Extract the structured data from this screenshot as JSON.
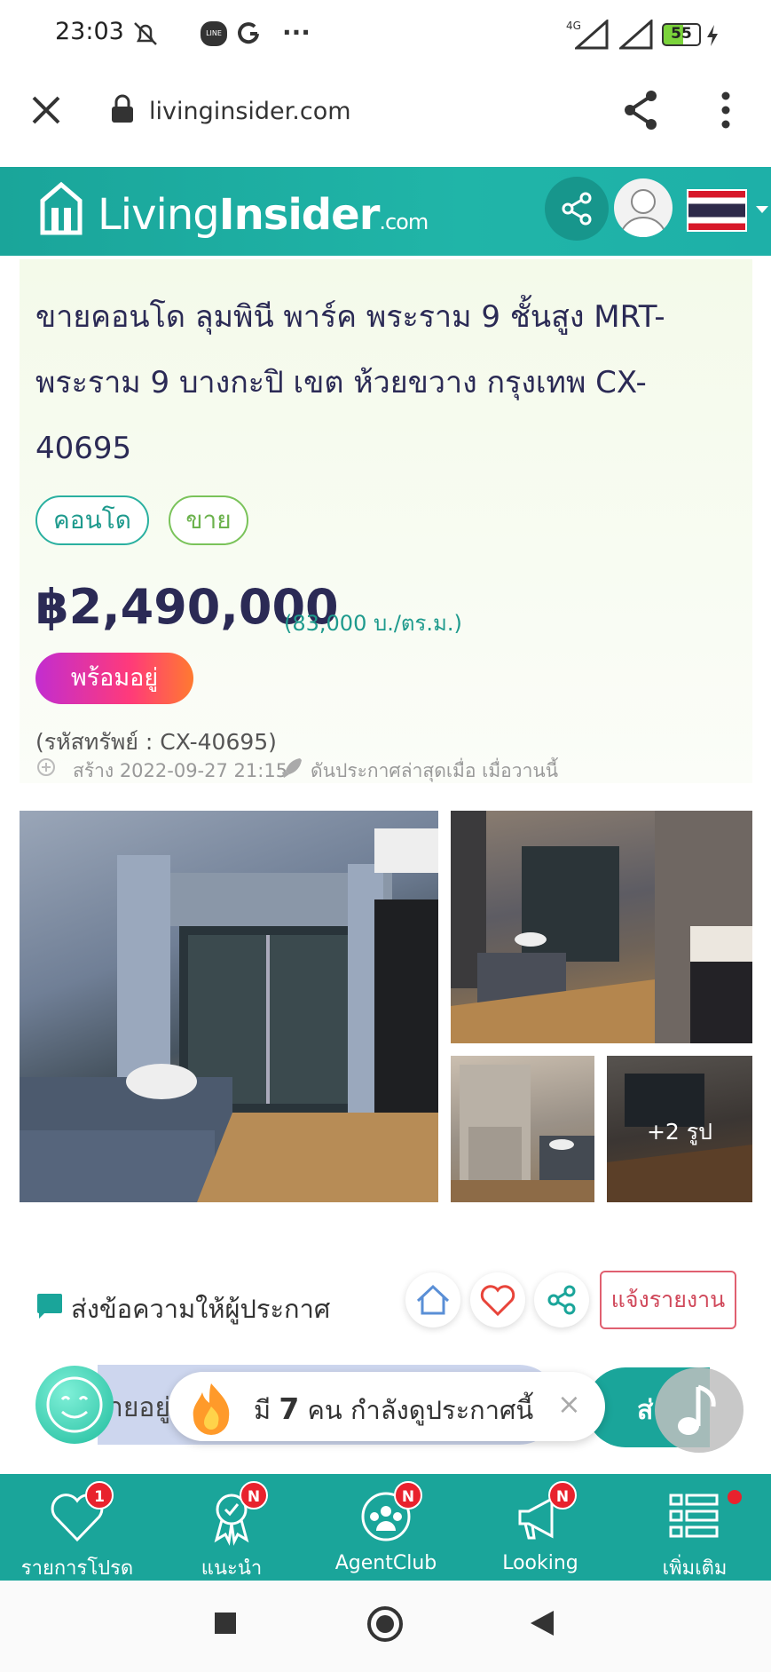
{
  "status_bar": {
    "time": "23:03",
    "network": "4G",
    "battery": "55"
  },
  "browser": {
    "url": "livinginsider.com"
  },
  "site_header": {
    "logo_living": "Living",
    "logo_insider": "Insider",
    "logo_com": ".com"
  },
  "listing": {
    "title": "ขายคอนโด ลุมพินี พาร์ค พระราม 9 ชั้นสูง MRT-พระราม 9 บางกะปิ เขต ห้วยขวาง กรุงเทพ CX-40695",
    "tags": [
      "คอนโด",
      "ขาย"
    ],
    "price": "฿2,490,000",
    "price_per_sqm": "(83,000 บ./ตร.ม.)",
    "ready_badge": "พร้อมอยู่",
    "asset_code": "(รหัสทรัพย์ : CX-40695)",
    "created": "สร้าง 2022-09-27 21:15",
    "boosted": "ดันประกาศล่าสุดเมื่อ เมื่อวานนี้",
    "more_photos": "+2 รูป"
  },
  "actions": {
    "message_label": "ส่งข้อความให้ผู้ประกาศ",
    "report_label": "แจ้งรายงาน"
  },
  "contact_bar": {
    "left_text": "ายอยู่",
    "right_text": "ส่"
  },
  "viewer_toast": {
    "prefix": "มี",
    "count": "7",
    "suffix": "คน กำลังดูประกาศนี้",
    "close": "×"
  },
  "bottom_nav": [
    {
      "label": "รายการโปรด",
      "badge": "1"
    },
    {
      "label": "แนะนำ",
      "badge": "N"
    },
    {
      "label": "AgentClub",
      "badge": "N"
    },
    {
      "label": "Looking",
      "badge": "N"
    },
    {
      "label": "เพิ่มเติม",
      "badge": ""
    }
  ],
  "colors": {
    "brand_teal": "#1aa59a",
    "price_navy": "#2b2a55",
    "badge_red": "#e8222d",
    "report_red": "#d0485a"
  }
}
